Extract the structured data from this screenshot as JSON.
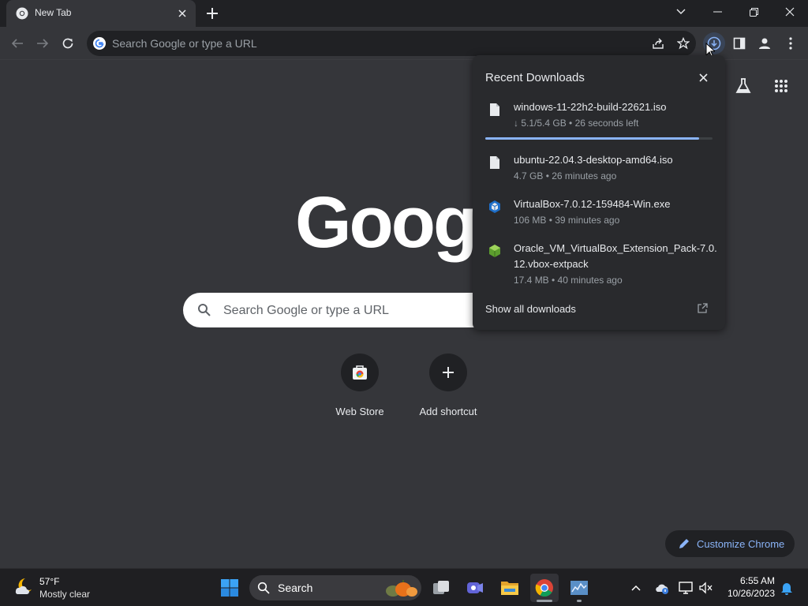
{
  "colors": {
    "frame": "#202124",
    "toolbar": "#35363a",
    "accent": "#8ab4f8",
    "bubble": "#292a2d",
    "taskbar": "#1f1f22"
  },
  "tab": {
    "title": "New Tab",
    "favicon": "chrome-icon",
    "close_icon": "close-icon"
  },
  "new_tab_icon": "plus-icon",
  "window_controls": [
    "chevron-down-icon",
    "minimize-icon",
    "restore-icon",
    "close-icon"
  ],
  "toolbar": {
    "back_icon": "back-arrow-icon",
    "forward_icon": "forward-arrow-icon",
    "reload_icon": "reload-icon",
    "omnibox_placeholder": "Search Google or type a URL",
    "share_icon": "share-icon",
    "bookmark_icon": "star-icon",
    "downloads_icon": "download-icon",
    "side_panel_icon": "side-panel-icon",
    "profile_icon": "profile-icon",
    "menu_icon": "kebab-menu-icon"
  },
  "ntp": {
    "logo_text": "Google",
    "search_placeholder": "Search Google or type a URL",
    "labs_icon": "flask-icon",
    "apps_icon": "apps-grid-icon",
    "shortcuts": [
      {
        "label": "Web Store",
        "icon": "web-store-icon"
      },
      {
        "label": "Add shortcut",
        "icon": "plus-icon"
      }
    ],
    "customize_label": "Customize Chrome",
    "customize_icon": "pencil-icon"
  },
  "downloads": {
    "title": "Recent Downloads",
    "items": [
      {
        "name": "windows-11-22h2-build-22621.iso",
        "status": "↓ 5.1/5.4 GB • 26 seconds left",
        "icon": "file-icon",
        "progress": 0.94
      },
      {
        "name": "ubuntu-22.04.3-desktop-amd64.iso",
        "status": "4.7 GB • 26 minutes ago",
        "icon": "file-icon"
      },
      {
        "name": "VirtualBox-7.0.12-159484-Win.exe",
        "status": "106 MB • 39 minutes ago",
        "icon": "virtualbox-icon"
      },
      {
        "name": "Oracle_VM_VirtualBox_Extension_Pack-7.0.12.vbox-extpack",
        "status": "17.4 MB • 40 minutes ago",
        "icon": "virtualbox-extpack-icon"
      }
    ],
    "show_all_label": "Show all downloads",
    "show_all_icon": "open-external-icon"
  },
  "taskbar": {
    "weather": {
      "temp": "57°F",
      "desc": "Mostly clear",
      "icon": "moon-cloud-icon"
    },
    "search_label": "Search",
    "apps": [
      "windows-start-icon",
      "task-view-icon",
      "teams-icon",
      "file-explorer-icon",
      "chrome-icon",
      "stock-chart-app-icon"
    ],
    "tray": [
      "chevron-up-icon",
      "onedrive-icon",
      "network-icon",
      "volume-mute-icon"
    ],
    "time": "6:55 AM",
    "date": "10/26/2023",
    "notification_icon": "bell-icon"
  }
}
